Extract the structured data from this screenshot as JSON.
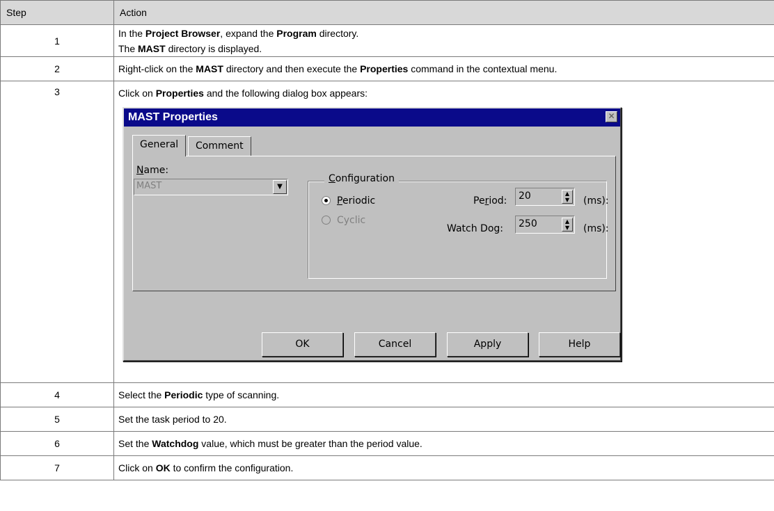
{
  "table": {
    "headers": {
      "step": "Step",
      "action": "Action"
    },
    "rows": [
      {
        "step": "1",
        "line1_pre": "In the ",
        "line1_b1": "Project Browser",
        "line1_mid": ", expand the ",
        "line1_b2": "Program",
        "line1_post": " directory.",
        "line2_pre": "The ",
        "line2_b1": "MAST",
        "line2_post": " directory is displayed."
      },
      {
        "step": "2",
        "pre": "Right-click on the ",
        "b1": "MAST",
        "mid": " directory and then execute the ",
        "b2": "Properties",
        "post": " command in the contextual menu."
      },
      {
        "step": "3",
        "pre": "Click on ",
        "b1": "Properties",
        "post": " and the following dialog box appears:"
      },
      {
        "step": "4",
        "pre": "Select the ",
        "b1": "Periodic",
        "post": " type of scanning."
      },
      {
        "step": "5",
        "text": "Set the task period to 20."
      },
      {
        "step": "6",
        "pre": "Set the ",
        "b1": "Watchdog",
        "post": " value, which must be greater than the period value."
      },
      {
        "step": "7",
        "pre": "Click on ",
        "b1": "OK",
        "post": " to confirm the configuration."
      }
    ]
  },
  "dialog": {
    "title": "MAST Properties",
    "close_glyph": "✕",
    "tabs": [
      {
        "label": "General"
      },
      {
        "label": "Comment"
      }
    ],
    "name_label_u": "N",
    "name_label_rest": "ame:",
    "name_value": "MAST",
    "combo_glyph": "▼",
    "configuration_u": "C",
    "configuration_rest": "onfiguration",
    "periodic_u": "P",
    "periodic_rest": "eriodic",
    "cyclic": "Cyclic",
    "period_pre": "Pe",
    "period_u": "r",
    "period_post": "iod:",
    "period_value": "20",
    "watchdog_label": "Watch Dog:",
    "watchdog_value": "250",
    "unit": "(ms):",
    "spin_glyph_up": "▲",
    "spin_glyph_down": "▼",
    "buttons": {
      "ok": "OK",
      "cancel": "Cancel",
      "apply": "Apply",
      "help": "Help"
    }
  }
}
